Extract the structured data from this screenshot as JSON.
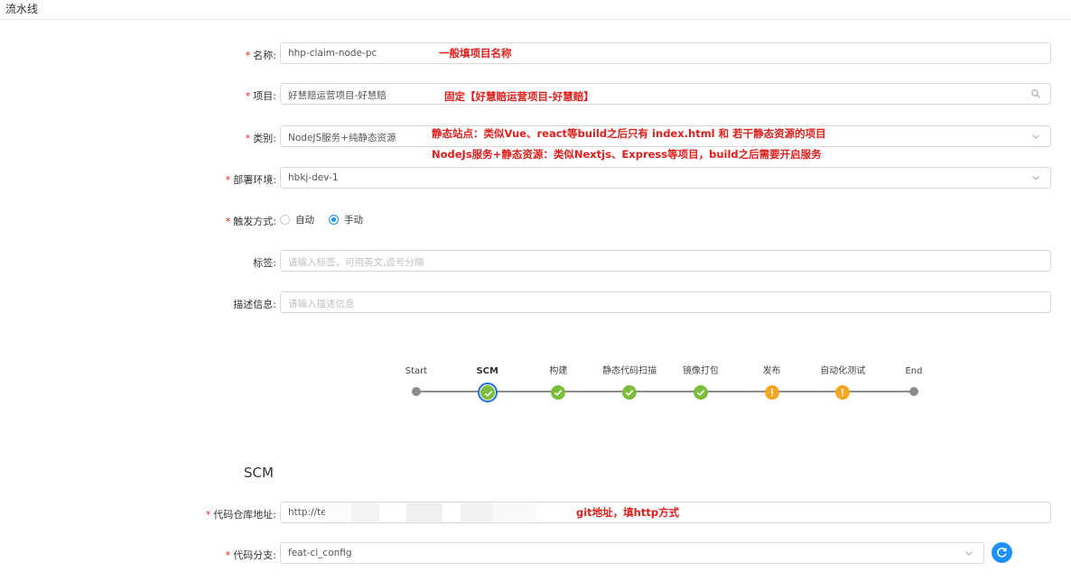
{
  "page": {
    "title": "流水线"
  },
  "form": {
    "name": {
      "label": "名称:",
      "value": "hhp-claim-node-pc",
      "note": "一般填项目名称"
    },
    "project": {
      "label": "项目:",
      "value": "好慧赔运营项目-好慧赔",
      "note": "固定【好慧赔运营项目-好慧赔】"
    },
    "category": {
      "label": "类别:",
      "value": "NodeJS服务+纯静态资源",
      "note1": "静态站点：类似Vue、react等build之后只有 index.html 和 若干静态资源的项目",
      "note2": "NodeJs服务+静态资源：类似Nextjs、Express等项目，build之后需要开启服务"
    },
    "env": {
      "label": "部署环境:",
      "value": "hbkj-dev-1"
    },
    "trigger": {
      "label": "触发方式:",
      "option_auto": "自动",
      "option_manual": "手动",
      "selected": "手动"
    },
    "tags": {
      "label": "标签:",
      "placeholder": "请输入标签，可用英文,逗号分隔"
    },
    "desc": {
      "label": "描述信息:",
      "placeholder": "请输入描述信息"
    }
  },
  "pipeline_steps": [
    {
      "label": "Start",
      "status": "dot"
    },
    {
      "label": "SCM",
      "status": "active"
    },
    {
      "label": "构建",
      "status": "ok"
    },
    {
      "label": "静态代码扫描",
      "status": "ok"
    },
    {
      "label": "镜像打包",
      "status": "ok"
    },
    {
      "label": "发布",
      "status": "warn"
    },
    {
      "label": "自动化测试",
      "status": "warn"
    },
    {
      "label": "End",
      "status": "dot"
    }
  ],
  "scm": {
    "section_title": "SCM",
    "repo": {
      "label": "代码仓库地址:",
      "value": "http://te",
      "note": "git地址，填http方式"
    },
    "branch": {
      "label": "代码分支:",
      "value": "feat-ci_config"
    }
  },
  "colors": {
    "required": "#f5222d",
    "annotation": "#e0201c",
    "ok": "#7cbd3d",
    "warn": "#f5a623",
    "primary": "#1890ff"
  }
}
